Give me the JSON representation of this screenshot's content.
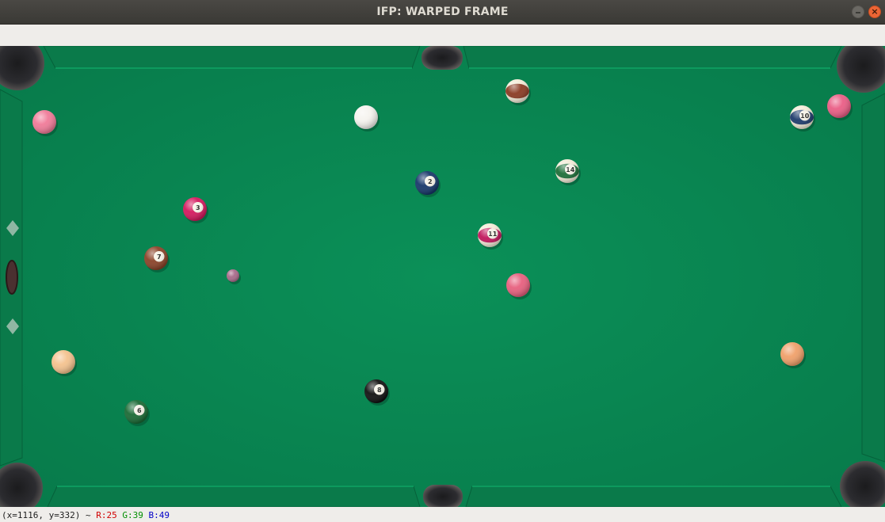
{
  "window": {
    "title": "IFP: WARPED FRAME",
    "minimize_symbol": "",
    "close_symbol": "×",
    "close_color": "#ec6535"
  },
  "table": {
    "felt_color": "#0a8a55",
    "cushion_color": "#0b7a49",
    "balls": [
      {
        "kind": "solid",
        "color": "#f07a98",
        "number": ""
      },
      {
        "kind": "cue",
        "color": "#f5f3ee",
        "number": ""
      },
      {
        "kind": "stripe",
        "color": "#8a3a22",
        "number": ""
      },
      {
        "kind": "stripe",
        "color": "#1d3a6b",
        "number": "10"
      },
      {
        "kind": "solid",
        "color": "#ea5d85",
        "number": ""
      },
      {
        "kind": "solid",
        "color": "#17376a",
        "number": "2"
      },
      {
        "kind": "stripe",
        "color": "#1c6e38",
        "number": "14"
      },
      {
        "kind": "solid",
        "color": "#d4185e",
        "number": "3"
      },
      {
        "kind": "stripe",
        "color": "#c0155c",
        "number": "11"
      },
      {
        "kind": "solid",
        "color": "#8a4228",
        "number": "7"
      },
      {
        "kind": "solid",
        "color": "#a86a8a",
        "number": ""
      },
      {
        "kind": "solid",
        "color": "#e75f7e",
        "number": ""
      },
      {
        "kind": "solid",
        "color": "#f4c28e",
        "number": ""
      },
      {
        "kind": "solid",
        "color": "#f0a06a",
        "number": ""
      },
      {
        "kind": "solid",
        "color": "#111111",
        "number": "8"
      },
      {
        "kind": "solid",
        "color": "#1a6a35",
        "number": "6"
      }
    ]
  },
  "status": {
    "position": "(x=1116, y=332) ~",
    "r": "R:25",
    "g": "G:39",
    "b": "B:49"
  }
}
